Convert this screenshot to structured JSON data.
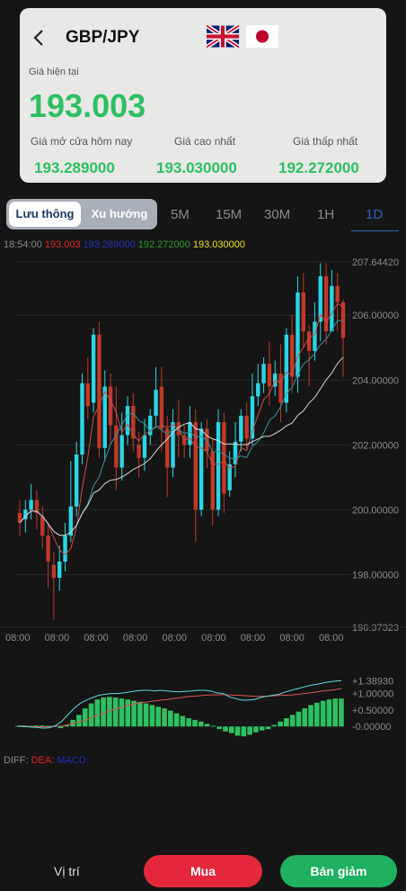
{
  "header": {
    "pair": "GBP/JPY",
    "flags": [
      "gb-flag-icon",
      "jp-flag-icon"
    ]
  },
  "price": {
    "current_label": "Giá hiện tại",
    "current_value": "193.003",
    "open_label": "Giá mở cửa hôm nay",
    "open_value": "193.289000",
    "high_label": "Giá cao nhất",
    "high_value": "193.030000",
    "low_label": "Giá thấp nhất",
    "low_value": "192.272000"
  },
  "tabs": {
    "active": "Lưu thông",
    "inactive": "Xu hướng"
  },
  "timeframes": [
    "5M",
    "15M",
    "30M",
    "1H",
    "1D"
  ],
  "active_timeframe": "1D",
  "info": {
    "time": "18:54:00",
    "v1": "193.003",
    "v2": "193.289000",
    "v3": "192.272000",
    "v4": "193.030000"
  },
  "macd": {
    "diff": "DIFF:",
    "dea": "DEA:",
    "macd": "MACD:"
  },
  "buttons": {
    "position": "Vị trí",
    "buy": "Mua",
    "sell": "Bán giảm"
  },
  "colors": {
    "up": "#2ad6e2",
    "down": "#c0392b",
    "green": "#2fbf63",
    "blue_active": "#2d64b8"
  },
  "chart_data": {
    "type": "candlestick",
    "y_ticks": [
      "207.64420",
      "206.00000",
      "204.00000",
      "202.00000",
      "200.00000",
      "198.00000",
      "196.37323"
    ],
    "ylim": [
      196.37323,
      207.6442
    ],
    "x_ticks": [
      "08:00",
      "08:00",
      "08:00",
      "08:00",
      "08:00",
      "08:00",
      "08:00",
      "08:00",
      "08:00"
    ],
    "candles": [
      [
        199.9,
        199.6,
        200.3,
        199.2
      ],
      [
        199.7,
        200.0,
        200.3,
        199.3
      ],
      [
        200.0,
        200.3,
        200.8,
        199.7
      ],
      [
        200.3,
        199.9,
        200.6,
        199.4
      ],
      [
        199.8,
        199.2,
        200.1,
        198.8
      ],
      [
        199.2,
        198.4,
        199.6,
        197.6
      ],
      [
        198.3,
        197.9,
        198.7,
        196.6
      ],
      [
        197.9,
        198.4,
        198.9,
        197.5
      ],
      [
        198.4,
        199.2,
        199.6,
        198.1
      ],
      [
        199.2,
        200.1,
        201.5,
        199.0
      ],
      [
        200.1,
        201.7,
        202.1,
        199.8
      ],
      [
        201.7,
        203.9,
        204.2,
        201.4
      ],
      [
        203.9,
        203.2,
        204.7,
        202.8
      ],
      [
        203.3,
        205.4,
        205.6,
        203.0
      ],
      [
        205.4,
        201.9,
        205.8,
        201.6
      ],
      [
        201.9,
        203.8,
        204.3,
        201.5
      ],
      [
        203.8,
        202.6,
        204.2,
        202.0
      ],
      [
        202.6,
        201.3,
        203.8,
        200.6
      ],
      [
        201.3,
        202.3,
        203.0,
        200.9
      ],
      [
        202.3,
        203.2,
        203.5,
        202.0
      ],
      [
        203.2,
        202.2,
        203.6,
        201.8
      ],
      [
        202.0,
        201.6,
        202.4,
        201.0
      ],
      [
        201.6,
        202.3,
        202.8,
        201.2
      ],
      [
        202.3,
        202.9,
        203.1,
        202.0
      ],
      [
        202.9,
        203.7,
        204.4,
        202.6
      ],
      [
        203.8,
        202.5,
        204.4,
        201.8
      ],
      [
        202.5,
        201.3,
        202.9,
        200.4
      ],
      [
        201.3,
        202.7,
        203.1,
        201.0
      ],
      [
        202.7,
        202.3,
        203.4,
        201.6
      ],
      [
        202.3,
        202.0,
        202.6,
        201.6
      ],
      [
        202.0,
        202.7,
        203.2,
        201.6
      ],
      [
        202.7,
        200.0,
        203.1,
        199.0
      ],
      [
        200.0,
        202.5,
        202.7,
        199.8
      ],
      [
        202.5,
        201.8,
        202.8,
        201.3
      ],
      [
        201.8,
        200.0,
        202.2,
        199.5
      ],
      [
        200.0,
        202.7,
        203.1,
        199.8
      ],
      [
        202.7,
        200.5,
        203.0,
        199.9
      ],
      [
        200.6,
        201.4,
        201.8,
        200.4
      ],
      [
        201.4,
        202.1,
        202.7,
        201.0
      ],
      [
        202.1,
        202.9,
        203.1,
        201.8
      ],
      [
        202.9,
        202.2,
        203.3,
        201.9
      ],
      [
        202.2,
        203.5,
        204.2,
        202.0
      ],
      [
        203.5,
        203.9,
        204.5,
        203.2
      ],
      [
        203.9,
        204.5,
        204.7,
        203.6
      ],
      [
        204.5,
        203.8,
        205.2,
        203.2
      ],
      [
        203.8,
        204.2,
        204.6,
        203.5
      ],
      [
        204.2,
        203.3,
        205.1,
        202.7
      ],
      [
        203.3,
        205.4,
        205.6,
        203.0
      ],
      [
        205.4,
        204.1,
        206.0,
        203.6
      ],
      [
        204.1,
        206.7,
        207.2,
        203.6
      ],
      [
        206.7,
        205.5,
        207.3,
        205.0
      ],
      [
        205.5,
        204.9,
        205.7,
        203.8
      ],
      [
        204.9,
        205.8,
        206.4,
        204.6
      ],
      [
        205.8,
        207.2,
        207.6,
        205.2
      ],
      [
        207.2,
        205.5,
        207.6,
        205.1
      ],
      [
        205.5,
        206.9,
        207.4,
        205.7
      ],
      [
        206.9,
        206.4,
        207.3,
        205.5
      ],
      [
        206.4,
        205.3,
        206.5,
        204.1
      ]
    ],
    "macd_ticks": [
      "+1.38930",
      "+1.00000",
      "+0.50000",
      "-0.00000"
    ],
    "macd_ylim": [
      -0.35,
      1.4
    ],
    "macd_bars": [
      0.02,
      0.03,
      0.02,
      0.03,
      0.03,
      0.02,
      0.02,
      -0.05,
      0.05,
      0.2,
      0.35,
      0.55,
      0.7,
      0.82,
      0.88,
      0.9,
      0.88,
      0.85,
      0.82,
      0.78,
      0.75,
      0.7,
      0.65,
      0.6,
      0.55,
      0.48,
      0.4,
      0.32,
      0.25,
      0.2,
      0.15,
      0.08,
      0.02,
      -0.08,
      -0.15,
      -0.2,
      -0.28,
      -0.3,
      -0.25,
      -0.18,
      -0.12,
      -0.08,
      0.05,
      0.15,
      0.25,
      0.35,
      0.45,
      0.55,
      0.65,
      0.72,
      0.78,
      0.82,
      0.85,
      0.85
    ],
    "diff_line": [
      0.02,
      0.0,
      -0.02,
      -0.03,
      -0.05,
      -0.04,
      0.02,
      0.15,
      0.35,
      0.55,
      0.7,
      0.8,
      0.88,
      0.95,
      0.98,
      1.0,
      1.0,
      1.02,
      1.05,
      1.08,
      1.1,
      1.1,
      1.08,
      1.1,
      1.08,
      1.06,
      1.05,
      1.07,
      1.08,
      1.1,
      1.1,
      1.08,
      1.02,
      1.0,
      0.9,
      0.85,
      0.8,
      0.8,
      0.82,
      0.88,
      0.92,
      0.95,
      0.98,
      1.05,
      1.1,
      1.15,
      1.2,
      1.25,
      1.28,
      1.32,
      1.35,
      1.38,
      1.39
    ],
    "dea_line": [
      0.0,
      0.0,
      0.0,
      0.0,
      -0.01,
      -0.01,
      0.0,
      0.02,
      0.05,
      0.1,
      0.15,
      0.2,
      0.28,
      0.35,
      0.42,
      0.5,
      0.55,
      0.6,
      0.65,
      0.7,
      0.73,
      0.75,
      0.78,
      0.8,
      0.82,
      0.85,
      0.87,
      0.9,
      0.92,
      0.93,
      0.95,
      0.96,
      0.96,
      0.97,
      0.96,
      0.95,
      0.94,
      0.93,
      0.92,
      0.92,
      0.92,
      0.93,
      0.94,
      0.95,
      0.96,
      0.98,
      1.0,
      1.02,
      1.05,
      1.08,
      1.1,
      1.12,
      1.15
    ]
  }
}
